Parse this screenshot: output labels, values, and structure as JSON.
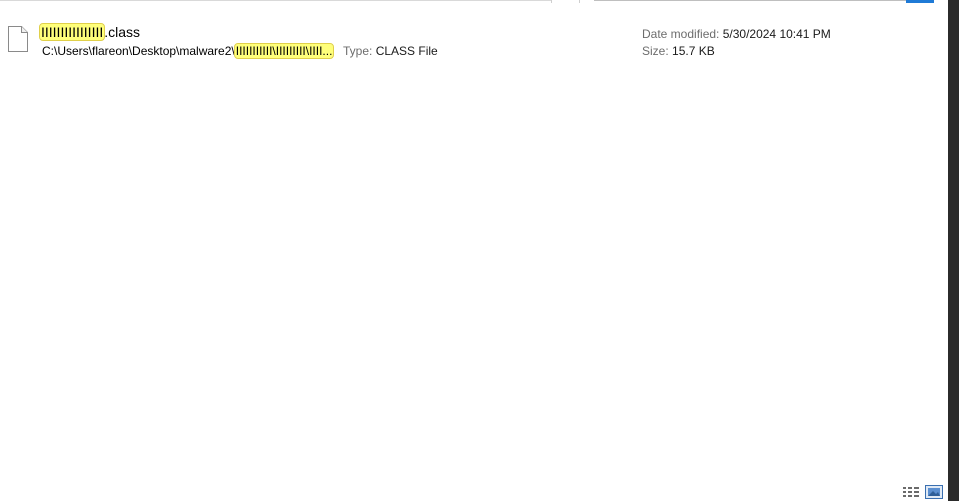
{
  "result": {
    "name_highlight": "IIIIIIIIIIIIIIII",
    "name_suffix": ".class",
    "path_prefix": "C:\\Users\\flareon\\Desktop\\malware2\\",
    "path_highlight": "IIIIIIIIIII\\IIIIIIIII\\IIII...",
    "type_label": "Type:",
    "type_value": "CLASS File",
    "date_label": "Date modified:",
    "date_value": "5/30/2024 10:41 PM",
    "size_label": "Size:",
    "size_value": "15.7 KB"
  },
  "icons": {
    "file": "file-icon",
    "details_view": "details-view-icon",
    "preview_view": "large-icons-view-icon"
  },
  "colors": {
    "highlight": "#ffff7a",
    "label_gray": "#6d6d6d",
    "accent_blue": "#1f7ad6"
  }
}
